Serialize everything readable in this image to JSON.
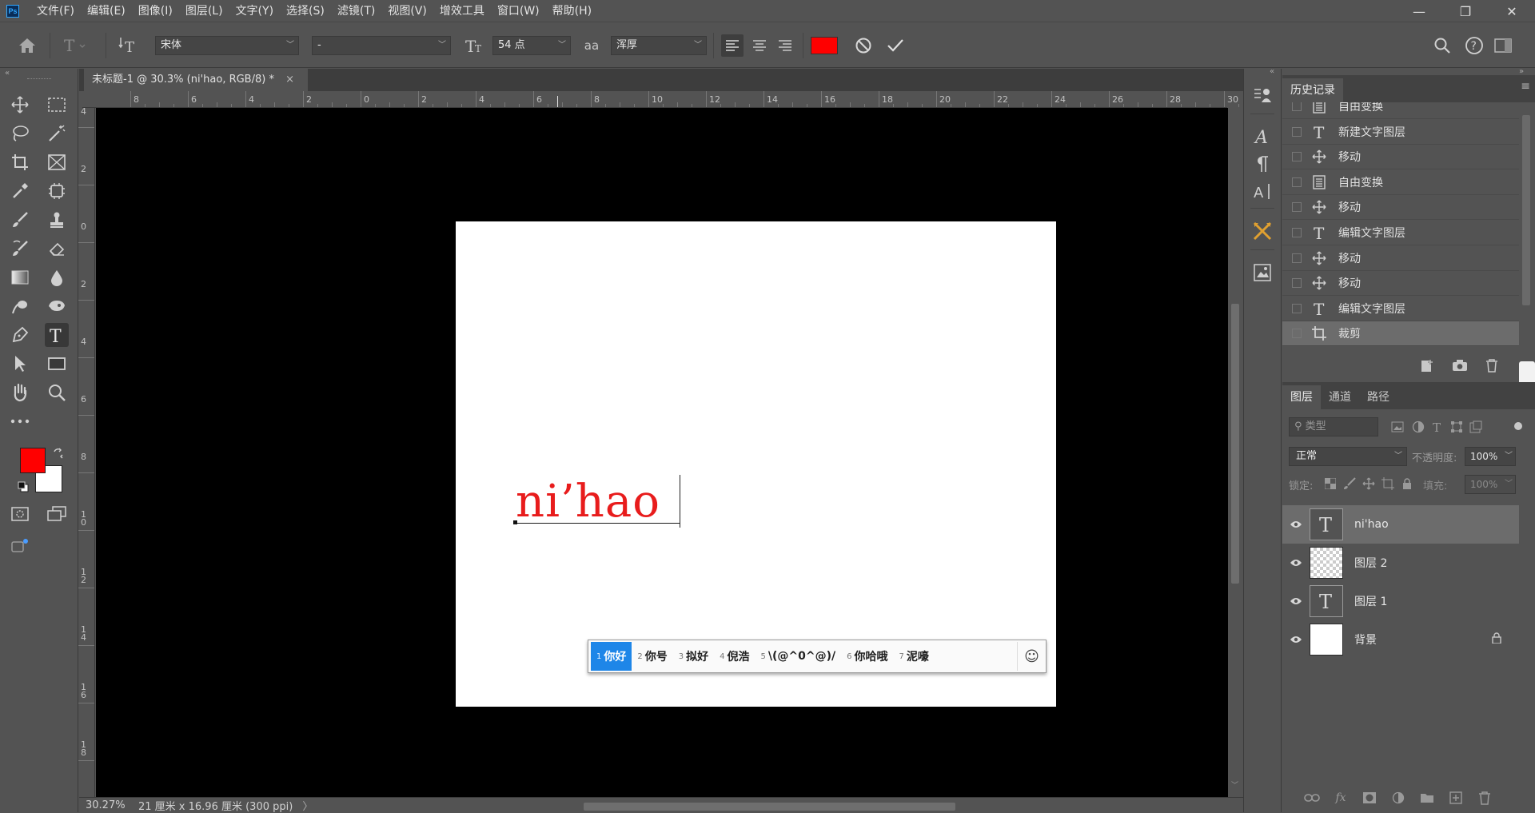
{
  "app": {
    "logo_text": "Ps"
  },
  "menu": [
    "文件(F)",
    "编辑(E)",
    "图像(I)",
    "图层(L)",
    "文字(Y)",
    "选择(S)",
    "滤镜(T)",
    "视图(V)",
    "增效工具",
    "窗口(W)",
    "帮助(H)"
  ],
  "window_controls": {
    "minimize": "—",
    "restore": "❐",
    "close": "✕"
  },
  "options": {
    "font_family": "宋体",
    "font_style": "-",
    "font_size": "54 点",
    "antialias_icon_text": "aa",
    "antialias": "浑厚",
    "text_color": "#ff0000"
  },
  "document": {
    "tab_title": "未标题-1 @ 30.3% (ni'hao, RGB/8) *",
    "close_glyph": "×",
    "typed_text": "ni’hao"
  },
  "ruler": {
    "h_labels": [
      "8",
      "6",
      "4",
      "2",
      "0",
      "2",
      "4",
      "6",
      "8",
      "10",
      "12",
      "14",
      "16",
      "18",
      "20",
      "22",
      "24",
      "26",
      "28",
      "30"
    ],
    "v_labels": [
      "4",
      "2",
      "0",
      "2",
      "4",
      "6",
      "8",
      "1\n0",
      "1\n2",
      "1\n4",
      "1\n6",
      "1\n8"
    ]
  },
  "ime": {
    "candidates": [
      {
        "num": "1",
        "text": "你好"
      },
      {
        "num": "2",
        "text": "你号"
      },
      {
        "num": "3",
        "text": "拟好"
      },
      {
        "num": "4",
        "text": "倪浩"
      },
      {
        "num": "5",
        "text": "\\(@^0^@)/"
      },
      {
        "num": "6",
        "text": "你哈哦"
      },
      {
        "num": "7",
        "text": "泥嚎"
      }
    ],
    "emoji_glyph": "☺"
  },
  "status": {
    "zoom": "30.27%",
    "doc_size": "21 厘米 x 16.96 厘米 (300 ppi)",
    "arrow": "〉"
  },
  "history": {
    "tab": "历史记录",
    "items": [
      {
        "icon": "doc",
        "label": "自由变换"
      },
      {
        "icon": "T",
        "label": "新建文字图层"
      },
      {
        "icon": "move",
        "label": "移动"
      },
      {
        "icon": "doc",
        "label": "自由变换"
      },
      {
        "icon": "move",
        "label": "移动"
      },
      {
        "icon": "T",
        "label": "编辑文字图层"
      },
      {
        "icon": "move",
        "label": "移动"
      },
      {
        "icon": "move",
        "label": "移动"
      },
      {
        "icon": "T",
        "label": "编辑文字图层"
      },
      {
        "icon": "crop",
        "label": "裁剪"
      }
    ]
  },
  "layers_panel": {
    "tabs": [
      "图层",
      "通道",
      "路径"
    ],
    "filter_placeholder": "类型",
    "blend_mode": "正常",
    "opacity_label": "不透明度:",
    "opacity_value": "100%",
    "lock_label": "锁定:",
    "fill_label": "填充:",
    "fill_value": "100%",
    "layers": [
      {
        "name": "ni'hao",
        "type": "text",
        "selected": true
      },
      {
        "name": "图层 2",
        "type": "transparent",
        "selected": false
      },
      {
        "name": "图层 1",
        "type": "text",
        "selected": false
      },
      {
        "name": "背景",
        "type": "white",
        "selected": false,
        "locked": true
      }
    ]
  },
  "colors": {
    "foreground": "#ff0000",
    "background": "#ffffff",
    "ime_selected": "#1e86e8",
    "typed_text": "#e81c1c"
  }
}
